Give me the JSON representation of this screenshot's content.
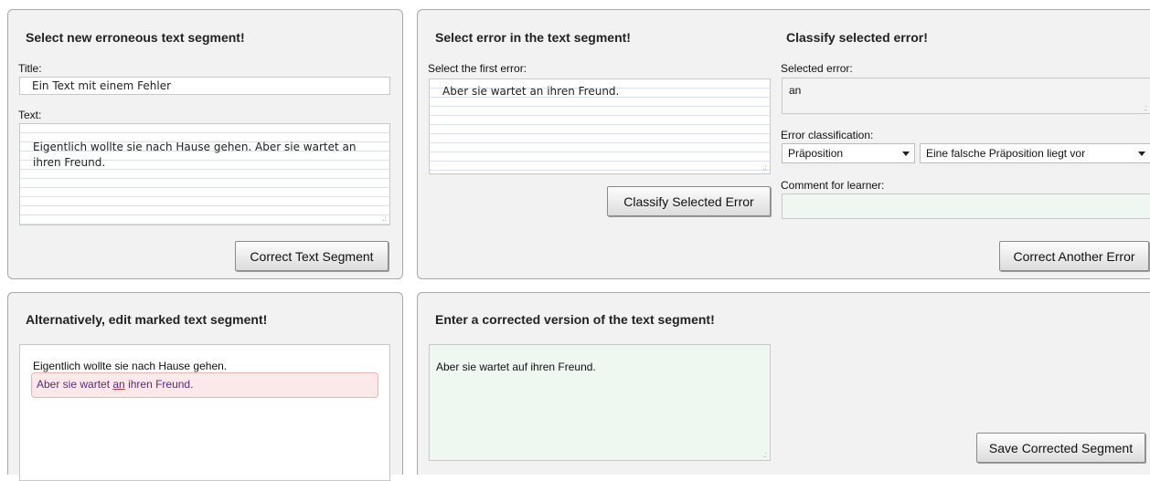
{
  "panel_select": {
    "title": "Select new erroneous text segment!",
    "title_label": "Title:",
    "title_value": "Ein Text mit einem Fehler",
    "text_label": "Text:",
    "text_value": "Eigentlich wollte sie nach Hause gehen. Aber sie wartet an ihren Freund.",
    "button": "Correct Text Segment"
  },
  "panel_error": {
    "title": "Select error in the text segment!",
    "first_error_label": "Select the first error:",
    "first_error_value": "Aber sie wartet an ihren Freund.",
    "button": "Classify Selected Error"
  },
  "panel_classify": {
    "title": "Classify selected error!",
    "selected_error_label": "Selected error:",
    "selected_error_value": "an",
    "classification_label": "Error classification:",
    "category_value": "Präposition",
    "subcategory_value": "Eine falsche Präposition liegt vor",
    "comment_label": "Comment for learner:",
    "comment_value": "",
    "button": "Correct Another Error"
  },
  "panel_edit": {
    "title": "Alternatively, edit marked text segment!",
    "line1": "Eigentlich wollte sie nach Hause gehen.",
    "marked_before": "Aber sie wartet ",
    "marked_error": "an",
    "marked_after": " ihren Freund."
  },
  "panel_correct": {
    "title": "Enter a corrected version of the text segment!",
    "corrected_value": "Aber sie wartet auf ihren Freund.",
    "button": "Save Corrected Segment"
  }
}
